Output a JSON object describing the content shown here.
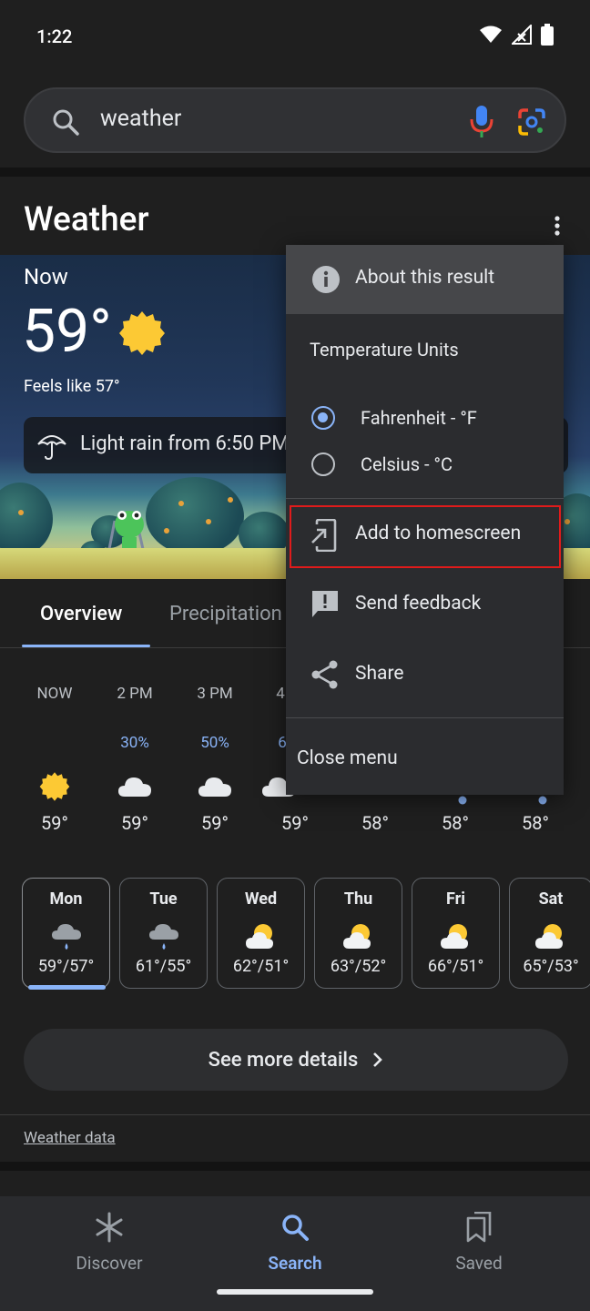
{
  "status_bar": {
    "time": "1:22",
    "icons": [
      "wifi-icon",
      "signal-icon",
      "battery-icon"
    ]
  },
  "search": {
    "query": "weather"
  },
  "weather": {
    "title": "Weather",
    "now_label": "Now",
    "temperature": "59°",
    "feels_like": "Feels like 57°",
    "rain_notice": "Light rain from 6:50 PM",
    "tabs": [
      "Overview",
      "Precipitation"
    ],
    "hourly": [
      {
        "time": "NOW",
        "pct": "",
        "icon": "sun",
        "temp": "59°"
      },
      {
        "time": "2 PM",
        "pct": "30%",
        "icon": "cloud",
        "temp": "59°"
      },
      {
        "time": "3 PM",
        "pct": "50%",
        "icon": "cloud",
        "temp": "59°"
      },
      {
        "time": "4",
        "pct": "6",
        "icon": "cloud",
        "temp": "59°"
      },
      {
        "time": "",
        "pct": "",
        "icon": "cloud",
        "temp": "58°"
      },
      {
        "time": "",
        "pct": "",
        "icon": "dot",
        "temp": "58°"
      },
      {
        "time": "",
        "pct": "",
        "icon": "dot",
        "temp": "58°"
      }
    ],
    "daily": [
      {
        "day": "Mon",
        "icon": "rain-cloud",
        "temp": "59°/57°"
      },
      {
        "day": "Tue",
        "icon": "rain-cloud",
        "temp": "61°/55°"
      },
      {
        "day": "Wed",
        "icon": "partly-sunny",
        "temp": "62°/51°"
      },
      {
        "day": "Thu",
        "icon": "partly-sunny",
        "temp": "63°/52°"
      },
      {
        "day": "Fri",
        "icon": "partly-sunny",
        "temp": "66°/51°"
      },
      {
        "day": "Sat",
        "icon": "partly-sunny",
        "temp": "65°/53°"
      }
    ],
    "see_more": "See more details",
    "weather_data_link": "Weather data"
  },
  "menu": {
    "about": "About this result",
    "units_title": "Temperature Units",
    "units": [
      {
        "label": "Fahrenheit - °F",
        "checked": true
      },
      {
        "label": "Celsius - °C",
        "checked": false
      }
    ],
    "add_homescreen": "Add to homescreen",
    "send_feedback": "Send feedback",
    "share": "Share",
    "close": "Close menu"
  },
  "bottom_nav": [
    {
      "label": "Discover",
      "icon": "asterisk-icon",
      "active": false
    },
    {
      "label": "Search",
      "icon": "search-icon",
      "active": true
    },
    {
      "label": "Saved",
      "icon": "saved-icon",
      "active": false
    }
  ],
  "colors": {
    "accent": "#8ab4f8",
    "highlight": "#e01b1b",
    "background": "#1f1f1f"
  }
}
